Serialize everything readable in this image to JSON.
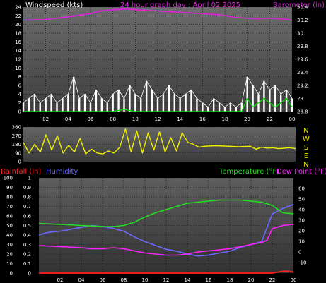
{
  "title": "24 hour graph day : April 02 2025",
  "colors": {
    "background": "#000000",
    "plot_top": "#595959",
    "plot_bottom": "#4f4f4f",
    "grid": "#000000",
    "wind": "#ffffff",
    "gust": "#00dd00",
    "barometer": "#e020e0",
    "direction": "#f0f000",
    "temperature": "#22dd22",
    "dew_point": "#ff22ff",
    "humidity": "#6a6aff",
    "rainfall": "#ff2020",
    "tick_text": "#ffffff"
  },
  "chart_data": [
    {
      "type": "line",
      "ylabel": "Windspeed (kts)",
      "ylabel_right": "Barometer (in)",
      "ylim": [
        0,
        24
      ],
      "yticks": [
        "0",
        "2",
        "4",
        "6",
        "8",
        "10",
        "12",
        "14",
        "16",
        "18",
        "20",
        "22",
        "24"
      ],
      "ylim_right": [
        28.8,
        30.4
      ],
      "yticks_right": [
        "28.8",
        "29",
        "29.2",
        "29.4",
        "29.6",
        "29.8",
        "30",
        "30.2",
        "30.4"
      ],
      "xlim": [
        0,
        24
      ],
      "xticks": [
        "02",
        "04",
        "06",
        "08",
        "10",
        "12",
        "14",
        "16",
        "18",
        "20",
        "22",
        "00"
      ],
      "series": [
        {
          "name": "Barometer (in)",
          "axis": "right",
          "x": [
            0,
            2,
            4,
            6,
            7,
            8,
            9,
            10,
            11,
            12,
            13,
            14,
            15,
            16,
            17,
            18,
            19,
            20,
            21,
            22,
            23,
            24
          ],
          "values": [
            30.2,
            30.21,
            30.25,
            30.3,
            30.34,
            30.36,
            30.37,
            30.36,
            30.35,
            30.34,
            30.33,
            30.32,
            30.31,
            30.3,
            30.29,
            30.27,
            30.24,
            30.23,
            30.22,
            30.23,
            30.22,
            30.2
          ]
        },
        {
          "name": "Windspeed (kts)",
          "axis": "left",
          "x": [
            0,
            0.5,
            1,
            1.5,
            2,
            2.5,
            3,
            3.5,
            4,
            4.5,
            5,
            5.5,
            6,
            6.5,
            7,
            7.5,
            8,
            8.5,
            9,
            9.5,
            10,
            10.5,
            11,
            11.5,
            12,
            12.5,
            13,
            13.5,
            14,
            14.5,
            15,
            15.5,
            16,
            16.5,
            17,
            17.5,
            18,
            18.5,
            19,
            19.5,
            20,
            20.5,
            21,
            21.5,
            22,
            22.5,
            23,
            23.5,
            24
          ],
          "values": [
            2,
            3,
            4,
            2,
            3,
            4,
            2,
            3,
            4,
            8,
            3,
            4,
            2,
            5,
            3,
            2,
            4,
            5,
            3,
            6,
            4,
            3,
            7,
            5,
            3,
            4,
            6,
            4,
            3,
            4,
            5,
            3,
            2,
            1,
            3,
            2,
            1,
            2,
            1,
            2,
            8,
            6,
            4,
            7,
            5,
            6,
            4,
            5,
            3
          ]
        },
        {
          "name": "Gust (kts)",
          "axis": "left",
          "x": [
            0,
            1,
            2,
            3,
            4,
            5,
            6,
            7,
            8,
            9,
            10,
            11,
            12,
            13,
            14,
            15,
            16,
            17,
            18,
            19,
            19.5,
            20,
            20.5,
            21,
            21.5,
            22,
            22.5,
            23,
            23.5,
            24
          ],
          "values": [
            0,
            0,
            0,
            0,
            0,
            0,
            0,
            0,
            0,
            0.5,
            0,
            0,
            0,
            0,
            0,
            0,
            0,
            0,
            0,
            0,
            0,
            3,
            1,
            2,
            3,
            2,
            1,
            2,
            3,
            1
          ]
        }
      ]
    },
    {
      "type": "line",
      "ylabel_right": "N W S E N",
      "ylim": [
        0,
        360
      ],
      "yticks": [
        "0",
        "90",
        "180",
        "270",
        "360"
      ],
      "xlim": [
        0,
        24
      ],
      "series": [
        {
          "name": "Wind direction",
          "axis": "left",
          "x": [
            0,
            0.5,
            1,
            1.5,
            2,
            2.5,
            3,
            3.5,
            4,
            4.5,
            5,
            5.5,
            6,
            6.5,
            7,
            7.5,
            8,
            8.5,
            9,
            9.5,
            10,
            10.5,
            11,
            11.5,
            12,
            12.5,
            13,
            13.5,
            14,
            14.5,
            15,
            15.5,
            16,
            17,
            18,
            19,
            20,
            20.5,
            21,
            21.5,
            22,
            22.5,
            23,
            23.5,
            24
          ],
          "values": [
            200,
            90,
            180,
            100,
            280,
            120,
            270,
            90,
            170,
            100,
            240,
            80,
            130,
            90,
            80,
            110,
            90,
            150,
            340,
            100,
            320,
            90,
            300,
            120,
            310,
            100,
            250,
            110,
            300,
            200,
            180,
            150,
            160,
            165,
            160,
            155,
            160,
            130,
            150,
            140,
            145,
            135,
            140,
            145,
            135
          ]
        }
      ]
    },
    {
      "type": "line",
      "ylabel_left_outer": "Rainfall (in)",
      "ylabel_left_inner": "Humidity",
      "ylabel_right": "Temperature (°F) Dew Point (°F)",
      "ylim_humidity": [
        0,
        100
      ],
      "yticks_humidity": [
        "0",
        "10",
        "20",
        "30",
        "40",
        "50",
        "60",
        "70",
        "80",
        "90",
        "100"
      ],
      "ylim_rain": [
        0,
        1
      ],
      "yticks_rain": [
        "0",
        "0.1",
        "0.2",
        "0.3",
        "0.4",
        "0.5",
        "0.6",
        "0.7",
        "0.8",
        "0.9",
        "1"
      ],
      "ylim_temp": [
        -20,
        70
      ],
      "yticks_temp": [
        "-10",
        "0",
        "10",
        "20",
        "30",
        "40",
        "50",
        "60"
      ],
      "xlim": [
        0,
        24
      ],
      "xticks": [
        "02",
        "04",
        "06",
        "08",
        "10",
        "12",
        "14",
        "16",
        "18",
        "20",
        "22",
        "00"
      ],
      "series": [
        {
          "name": "Temperature (°F)",
          "axis": "temp",
          "x": [
            0,
            2,
            4,
            6,
            7,
            8,
            9,
            10,
            11,
            12,
            13,
            14,
            15,
            16,
            17,
            18,
            19,
            20,
            21,
            22,
            23,
            24
          ],
          "values": [
            27,
            26,
            25,
            24,
            24,
            25,
            28,
            33,
            37,
            40,
            43,
            46,
            47,
            48,
            49,
            49,
            49,
            48,
            47,
            44,
            37,
            36
          ]
        },
        {
          "name": "Dew Point (°F)",
          "axis": "temp",
          "x": [
            0,
            2,
            4,
            5,
            6,
            7,
            8,
            9,
            10,
            11,
            12,
            13,
            14,
            15,
            16,
            17,
            18,
            19,
            20,
            21,
            21.5,
            22,
            23,
            24
          ],
          "values": [
            6,
            5,
            4,
            3,
            3,
            4,
            3,
            1,
            -1,
            -2,
            -3,
            -3,
            -2,
            0,
            1,
            2,
            3,
            5,
            7,
            9,
            11,
            22,
            25,
            26
          ]
        },
        {
          "name": "Humidity",
          "axis": "humidity",
          "x": [
            0,
            1,
            2,
            3,
            4,
            5,
            6,
            7,
            8,
            9,
            10,
            11,
            12,
            13,
            14,
            15,
            16,
            17,
            18,
            19,
            20,
            21,
            22,
            23,
            24
          ],
          "values": [
            40,
            43,
            44,
            46,
            48,
            50,
            49,
            47,
            44,
            38,
            33,
            29,
            25,
            23,
            20,
            18,
            19,
            21,
            23,
            27,
            30,
            33,
            62,
            68,
            72
          ]
        },
        {
          "name": "Rainfall (in)",
          "axis": "rain",
          "x": [
            0,
            20,
            21,
            22,
            22.5,
            23,
            23.5,
            24
          ],
          "values": [
            0,
            0,
            0,
            0,
            0.01,
            0.02,
            0.02,
            0.01
          ]
        }
      ]
    }
  ]
}
